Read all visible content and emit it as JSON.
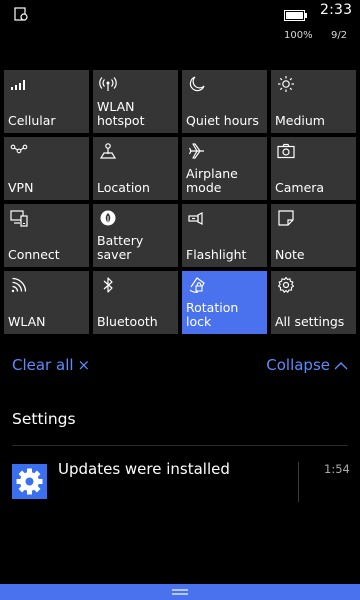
{
  "status_bar": {
    "time": "2:33",
    "battery_percent": "100%",
    "date": "9/2",
    "left_icon": "notification-settings-icon",
    "battery_icon": "battery-icon"
  },
  "quick_actions": [
    {
      "label": "Cellular",
      "icon": "signal-bars-icon",
      "active": false
    },
    {
      "label": "WLAN\nhotspot",
      "icon": "hotspot-icon",
      "active": false
    },
    {
      "label": "Quiet hours",
      "icon": "moon-icon",
      "active": false
    },
    {
      "label": "Medium",
      "icon": "brightness-icon",
      "active": false
    },
    {
      "label": "VPN",
      "icon": "vpn-icon",
      "active": false
    },
    {
      "label": "Location",
      "icon": "location-icon",
      "active": false
    },
    {
      "label": "Airplane\nmode",
      "icon": "airplane-icon",
      "active": false
    },
    {
      "label": "Camera",
      "icon": "camera-icon",
      "active": false
    },
    {
      "label": "Connect",
      "icon": "connect-icon",
      "active": false
    },
    {
      "label": "Battery saver",
      "icon": "battery-saver-icon",
      "active": false
    },
    {
      "label": "Flashlight",
      "icon": "flashlight-icon",
      "active": false
    },
    {
      "label": "Note",
      "icon": "note-icon",
      "active": false
    },
    {
      "label": "WLAN",
      "icon": "wifi-icon",
      "active": false
    },
    {
      "label": "Bluetooth",
      "icon": "bluetooth-icon",
      "active": false
    },
    {
      "label": "Rotation lock",
      "icon": "rotation-lock-icon",
      "active": true
    },
    {
      "label": "All settings",
      "icon": "gear-icon",
      "active": false
    }
  ],
  "actions": {
    "clear_all": "Clear all",
    "clear_icon": "×",
    "collapse": "Collapse",
    "collapse_icon": "chevron-up-icon"
  },
  "notifications": {
    "group_title": "Settings",
    "items": [
      {
        "title": "Updates were installed",
        "time": "1:54",
        "icon": "settings-gear-icon"
      }
    ]
  },
  "colors": {
    "accent": "#4a72ee",
    "tile_bg": "#353535",
    "link": "#5b8cff",
    "background": "#000000"
  }
}
